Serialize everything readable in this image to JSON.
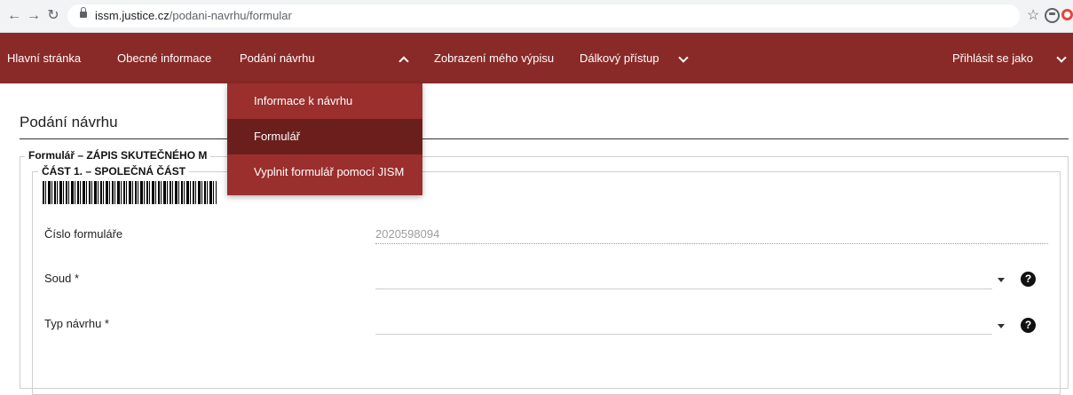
{
  "browser": {
    "url_domain": "issm.justice.cz",
    "url_path": "/podani-navrhu/formular"
  },
  "topnav": {
    "items": [
      {
        "label": "Hlavní stránka"
      },
      {
        "label": "Obecné informace"
      },
      {
        "label": "Podání návrhu"
      },
      {
        "label": "Zobrazení mého výpisu"
      },
      {
        "label": "Dálkový přístup"
      }
    ],
    "login_label": "Přihlásit se jako"
  },
  "dropdown": {
    "items": [
      {
        "label": "Informace k návrhu"
      },
      {
        "label": "Formulář"
      },
      {
        "label": "Vyplnit formulář pomocí JISM"
      }
    ]
  },
  "page": {
    "title": "Podání návrhu",
    "form_legend": "Formulář – ZÁPIS SKUTEČNÉHO M",
    "section_legend": "ČÁST 1. – SPOLEČNÁ ČÁST",
    "fields": [
      {
        "label": "Číslo formuláře",
        "value": "2020598094"
      },
      {
        "label": "Soud *",
        "value": ""
      },
      {
        "label": "Typ návrhu *",
        "value": ""
      }
    ]
  }
}
